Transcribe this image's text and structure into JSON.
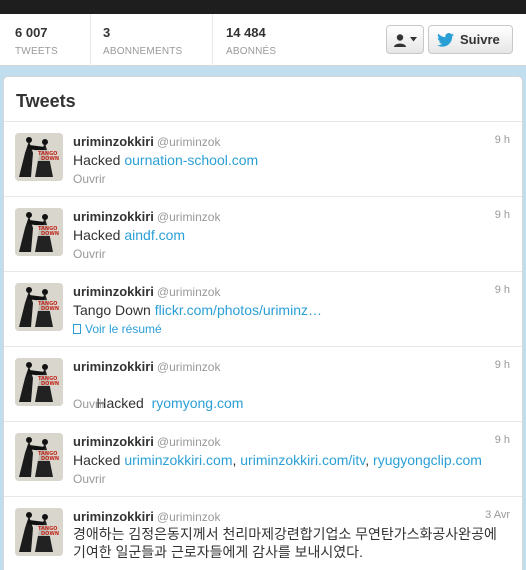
{
  "stats": [
    {
      "value": "6 007",
      "label": "TWEETS"
    },
    {
      "value": "3",
      "label": "ABONNEMENTS"
    },
    {
      "value": "14 484",
      "label": "ABONNÉS"
    }
  ],
  "follow_label": "Suivre",
  "tweets_title": "Tweets",
  "tweets": [
    {
      "name": "uriminzokkiri",
      "handle": "@uriminzok",
      "time": "9 h",
      "prefix": "Hacked ",
      "links": [
        "ournation-school.com"
      ],
      "action": "Ouvrir"
    },
    {
      "name": "uriminzokkiri",
      "handle": "@uriminzok",
      "time": "9 h",
      "prefix": "Hacked ",
      "links": [
        "aindf.com"
      ],
      "action": "Ouvrir"
    },
    {
      "name": "uriminzokkiri",
      "handle": "@uriminzok",
      "time": "9 h",
      "prefix": "Tango Down ",
      "links": [
        "flickr.com/photos/uriminz…"
      ],
      "action": "Voir le résumé"
    },
    {
      "name": "uriminzokkiri",
      "handle": "@uriminzok",
      "time": "9 h",
      "prefix": "Hacked  ",
      "links": [
        "ryomyong.com"
      ],
      "action": "Ouvrir"
    },
    {
      "name": "uriminzokkiri",
      "handle": "@uriminzok",
      "time": "9 h",
      "prefix": "Hacked ",
      "links": [
        "uriminzokkiri.com",
        "uriminzokkiri.com/itv",
        "ryugyongclip.com"
      ],
      "separator": ", ",
      "action": "Ouvrir"
    },
    {
      "name": "uriminzokkiri",
      "handle": "@uriminzok",
      "time": "3 Avr",
      "text": "경애하는 김정은동지께서 천리마제강련합기업소 무연탄가스화공사완공에 기여한 일군들과 근로자들에게 감사를 보내시였다."
    }
  ],
  "colors": {
    "link": "#2a9fd6",
    "background": "#c0deed",
    "topbar": "#1e1e1e"
  },
  "icons": {
    "user_menu": "person-icon",
    "follow": "twitter-bird-icon",
    "summary": "document-icon"
  }
}
